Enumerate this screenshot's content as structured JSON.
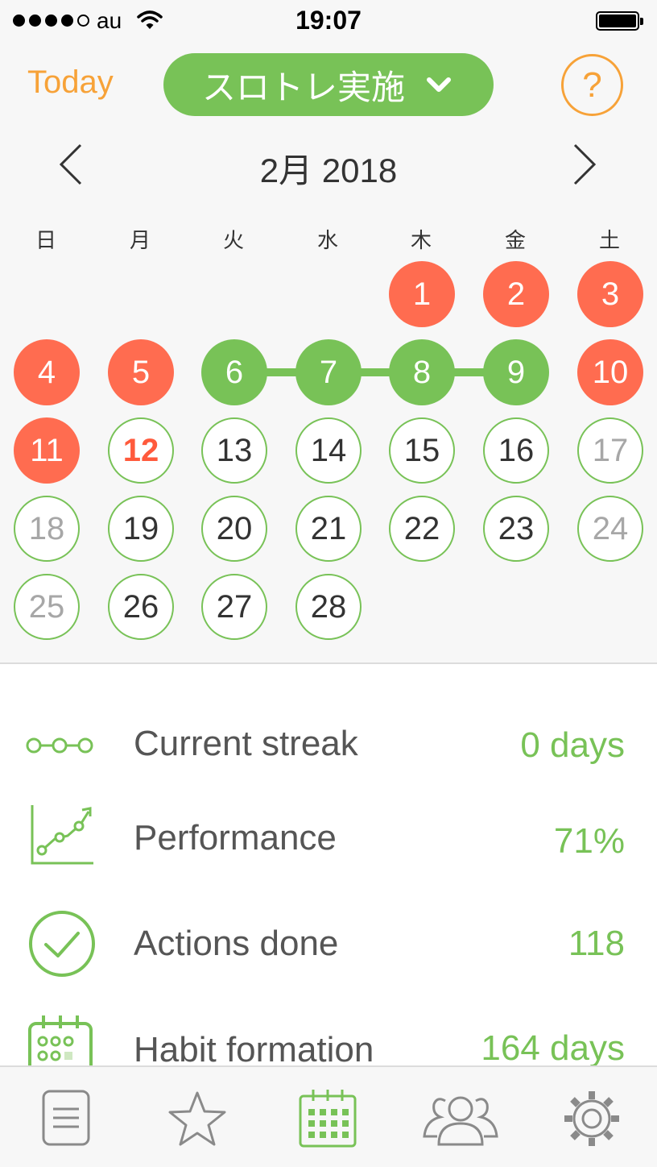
{
  "status_bar": {
    "carrier": "au",
    "time": "19:07"
  },
  "header": {
    "today_label": "Today",
    "habit_name": "スロトレ実施",
    "help_label": "?"
  },
  "calendar": {
    "month_label": "2月 2018",
    "weekdays": [
      "日",
      "月",
      "火",
      "水",
      "木",
      "金",
      "土"
    ],
    "days": [
      {
        "n": "1",
        "state": "missed"
      },
      {
        "n": "2",
        "state": "missed"
      },
      {
        "n": "3",
        "state": "missed"
      },
      {
        "n": "4",
        "state": "missed"
      },
      {
        "n": "5",
        "state": "missed"
      },
      {
        "n": "6",
        "state": "done"
      },
      {
        "n": "7",
        "state": "done"
      },
      {
        "n": "8",
        "state": "done"
      },
      {
        "n": "9",
        "state": "done"
      },
      {
        "n": "10",
        "state": "missed"
      },
      {
        "n": "11",
        "state": "missed"
      },
      {
        "n": "12",
        "state": "today"
      },
      {
        "n": "13",
        "state": "upcoming"
      },
      {
        "n": "14",
        "state": "upcoming"
      },
      {
        "n": "15",
        "state": "upcoming"
      },
      {
        "n": "16",
        "state": "upcoming"
      },
      {
        "n": "17",
        "state": "weekend"
      },
      {
        "n": "18",
        "state": "weekend"
      },
      {
        "n": "19",
        "state": "upcoming"
      },
      {
        "n": "20",
        "state": "upcoming"
      },
      {
        "n": "21",
        "state": "upcoming"
      },
      {
        "n": "22",
        "state": "upcoming"
      },
      {
        "n": "23",
        "state": "upcoming"
      },
      {
        "n": "24",
        "state": "weekend"
      },
      {
        "n": "25",
        "state": "weekend"
      },
      {
        "n": "26",
        "state": "upcoming"
      },
      {
        "n": "27",
        "state": "upcoming"
      },
      {
        "n": "28",
        "state": "upcoming"
      }
    ]
  },
  "stats": [
    {
      "icon": "streak-icon",
      "label": "Current streak",
      "value": "0 days"
    },
    {
      "icon": "performance-chart-icon",
      "label": "Performance",
      "value": "71%"
    },
    {
      "icon": "checkmark-circle-icon",
      "label": "Actions done",
      "value": "118"
    },
    {
      "icon": "habit-calendar-icon",
      "label": "Habit formation",
      "value": "164 days"
    }
  ],
  "tabs": [
    {
      "icon": "list-icon"
    },
    {
      "icon": "star-icon"
    },
    {
      "icon": "calendar-icon",
      "active": true
    },
    {
      "icon": "group-icon"
    },
    {
      "icon": "gear-icon"
    }
  ],
  "colors": {
    "accent_green": "#78c257",
    "missed_red": "#ff6c50",
    "today_orange": "#f7a238"
  }
}
